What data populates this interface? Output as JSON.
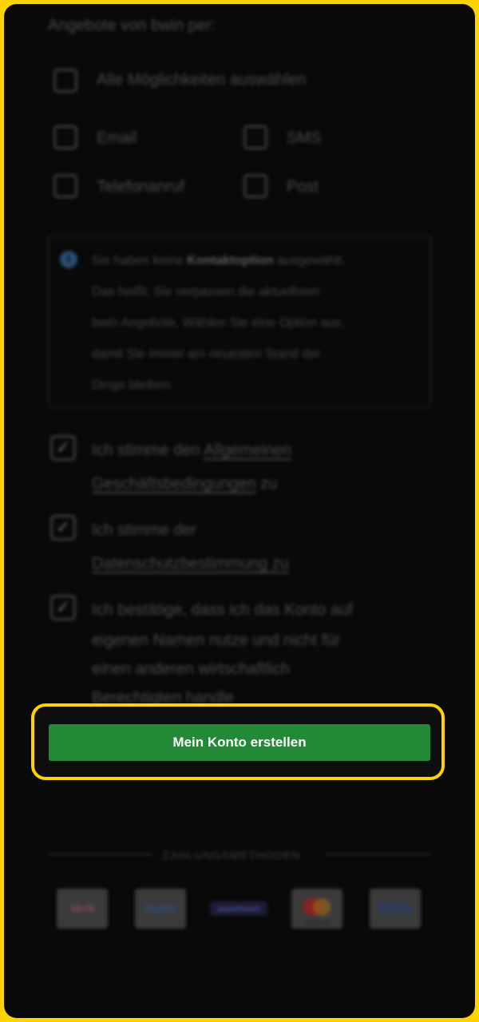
{
  "offers": {
    "heading": "Angebote von bwin per:",
    "select_all_label": "Alle Möglichkeiten auswählen",
    "options": {
      "email": "Email",
      "sms": "SMS",
      "phone": "Telefonanruf",
      "post": "Post"
    }
  },
  "info": {
    "icon": "info-icon",
    "text_before": "Sie haben keine ",
    "text_bold": "Kontaktoption",
    "text_after": " ausgewählt.",
    "line2": "Das heißt, Sie verpassen die aktuellsten",
    "line3": "bwin Angebote. Wählen Sie eine Option aus,",
    "line4": "damit Sie immer am neuesten Stand der",
    "line5": "Dinge bleiben."
  },
  "consents": {
    "check_mark": "✓",
    "terms": {
      "prefix": "Ich stimme den ",
      "link_line1": "Allgemeinen",
      "link_line2": "Geschäftsbedingungen",
      "suffix": " zu"
    },
    "privacy": {
      "prefix": "Ich stimme der",
      "link": "Datenschutzbestimmung zu"
    },
    "own_account": {
      "line1": "Ich bestätige, dass ich das Konto auf",
      "line2": "eigenen Namen nutze und nicht für",
      "line3": "einen anderen wirtschaftlich",
      "line4": "Berechtigten handle"
    }
  },
  "cta": {
    "label": "Mein Konto erstellen"
  },
  "payments": {
    "heading": "ZAHLUNGSMETHODEN",
    "methods": {
      "skrill": "Skrill",
      "paypal": "PayPal",
      "paysafe": "paysafecard",
      "mastercard": "mastercard",
      "visa": "VISA"
    }
  },
  "colors": {
    "highlight": "#fdd400",
    "cta_green": "#228936",
    "background": "#090909"
  }
}
